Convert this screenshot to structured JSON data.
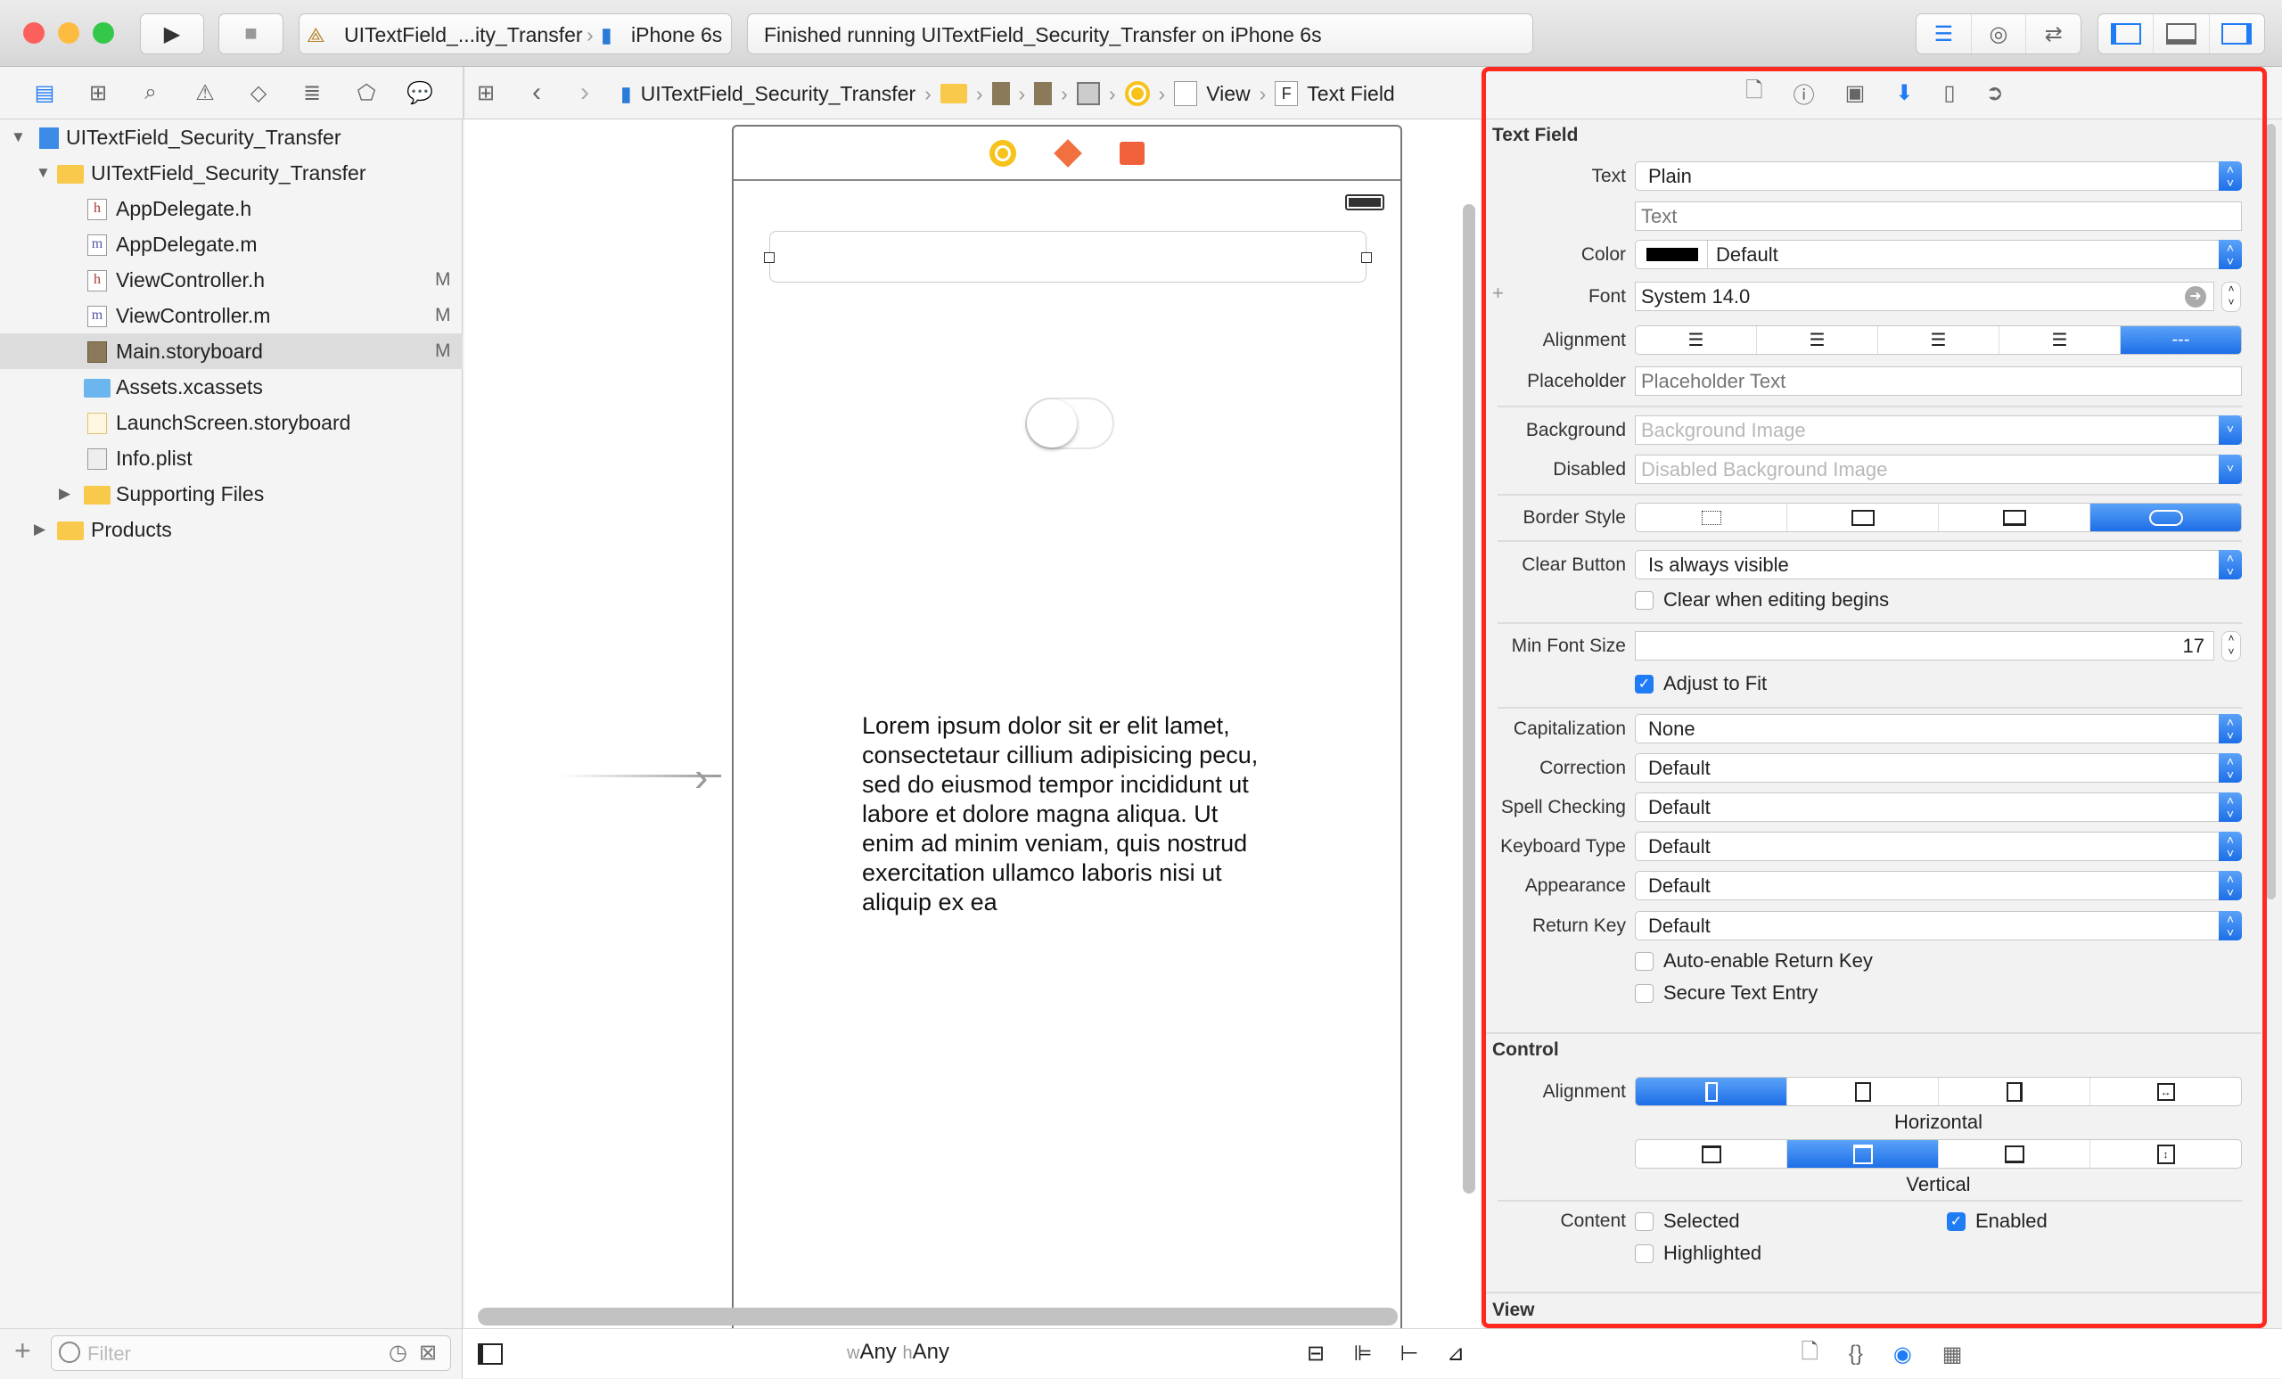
{
  "toolbar": {
    "scheme": "UITextField_...ity_Transfer",
    "device": "iPhone 6s",
    "status": "Finished running UITextField_Security_Transfer on iPhone 6s"
  },
  "jumpbar": {
    "project": "UITextField_Security_Transfer",
    "view": "View",
    "field_letter": "F",
    "field": "Text Field"
  },
  "navigator": {
    "items": [
      {
        "label": "UITextField_Security_Transfer",
        "flag": ""
      },
      {
        "label": "UITextField_Security_Transfer",
        "flag": ""
      },
      {
        "label": "AppDelegate.h",
        "flag": "",
        "type": "h"
      },
      {
        "label": "AppDelegate.m",
        "flag": "",
        "type": "m"
      },
      {
        "label": "ViewController.h",
        "flag": "M",
        "type": "h"
      },
      {
        "label": "ViewController.m",
        "flag": "M",
        "type": "m"
      },
      {
        "label": "Main.storyboard",
        "flag": "M"
      },
      {
        "label": "Assets.xcassets",
        "flag": ""
      },
      {
        "label": "LaunchScreen.storyboard",
        "flag": ""
      },
      {
        "label": "Info.plist",
        "flag": ""
      },
      {
        "label": "Supporting Files",
        "flag": ""
      },
      {
        "label": "Products",
        "flag": ""
      }
    ],
    "filter_placeholder": "Filter",
    "h": "h",
    "m": "m"
  },
  "canvas": {
    "label_text": "Lorem ipsum dolor sit er elit lamet, consectetaur cillium adipisicing pecu, sed do eiusmod tempor incididunt ut labore et dolore magna aliqua. Ut enim ad minim veniam, quis nostrud exercitation ullamco laboris nisi ut aliquip ex ea",
    "size_w": "w",
    "size_w_val": "Any",
    "size_h": "h",
    "size_h_val": "Any",
    "switch_on": false
  },
  "inspector": {
    "section_title": "Text Field",
    "text_label": "Text",
    "text_value": "Plain",
    "text_placeholder": "Text",
    "color_label": "Color",
    "color_value": "Default",
    "color_swatch": "#000000",
    "font_label": "Font",
    "font_value": "System 14.0",
    "alignment_label": "Alignment",
    "alignment_selected": 4,
    "placeholder_label": "Placeholder",
    "placeholder_placeholder": "Placeholder Text",
    "background_label": "Background",
    "background_placeholder": "Background Image",
    "disabled_label": "Disabled",
    "disabled_placeholder": "Disabled Background Image",
    "border_label": "Border Style",
    "border_selected": 3,
    "clear_label": "Clear Button",
    "clear_value": "Is always visible",
    "clear_editing": "Clear when editing begins",
    "clear_editing_checked": false,
    "minfont_label": "Min Font Size",
    "minfont_value": "17",
    "adjust": "Adjust to Fit",
    "adjust_checked": true,
    "cap_label": "Capitalization",
    "cap_value": "None",
    "corr_label": "Correction",
    "corr_value": "Default",
    "spell_label": "Spell Checking",
    "spell_value": "Default",
    "kbd_label": "Keyboard Type",
    "kbd_value": "Default",
    "appear_label": "Appearance",
    "appear_value": "Default",
    "return_label": "Return Key",
    "return_value": "Default",
    "auto_return": "Auto-enable Return Key",
    "auto_return_checked": false,
    "secure": "Secure Text Entry",
    "secure_checked": false,
    "control_title": "Control",
    "calign_label": "Alignment",
    "horizontal": "Horizontal",
    "vertical": "Vertical",
    "h_selected": 0,
    "v_selected": 1,
    "content_label": "Content",
    "selected": "Selected",
    "selected_checked": false,
    "enabled": "Enabled",
    "enabled_checked": true,
    "highlighted": "Highlighted",
    "highlighted_checked": false,
    "view_title": "View"
  },
  "colors": {
    "accent": "#1f7cf5",
    "highlight_border": "#ff2a1f"
  }
}
